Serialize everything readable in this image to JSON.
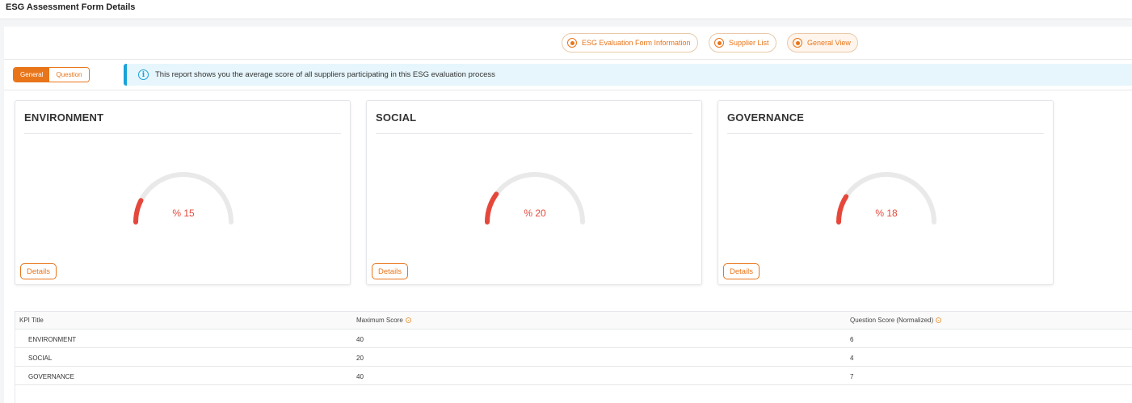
{
  "header": {
    "title": "ESG Assessment Form Details"
  },
  "tabs": [
    {
      "label": "ESG Evaluation Form Information"
    },
    {
      "label": "Supplier List"
    },
    {
      "label": "General View"
    }
  ],
  "view_toggle": {
    "general": "General",
    "question": "Question"
  },
  "info": {
    "text": "This report shows you the average score of all suppliers participating in this ESG evaluation process"
  },
  "cards": [
    {
      "title": "ENVIRONMENT",
      "value_text": "% 15",
      "value": 15,
      "details": "Details"
    },
    {
      "title": "SOCIAL",
      "value_text": "% 20",
      "value": 20,
      "details": "Details"
    },
    {
      "title": "GOVERNANCE",
      "value_text": "% 18",
      "value": 18,
      "details": "Details"
    }
  ],
  "colors": {
    "accent": "#e8751a",
    "gauge": "#e5483b",
    "track": "#e9e9e9",
    "info": "#1aa3d9"
  },
  "table": {
    "columns": [
      "KPI Title",
      "Maximum Score",
      "Question Score (Normalized)"
    ],
    "rows": [
      [
        "ENVIRONMENT",
        "40",
        "6"
      ],
      [
        "SOCIAL",
        "20",
        "4"
      ],
      [
        "GOVERNANCE",
        "40",
        "7"
      ]
    ]
  }
}
